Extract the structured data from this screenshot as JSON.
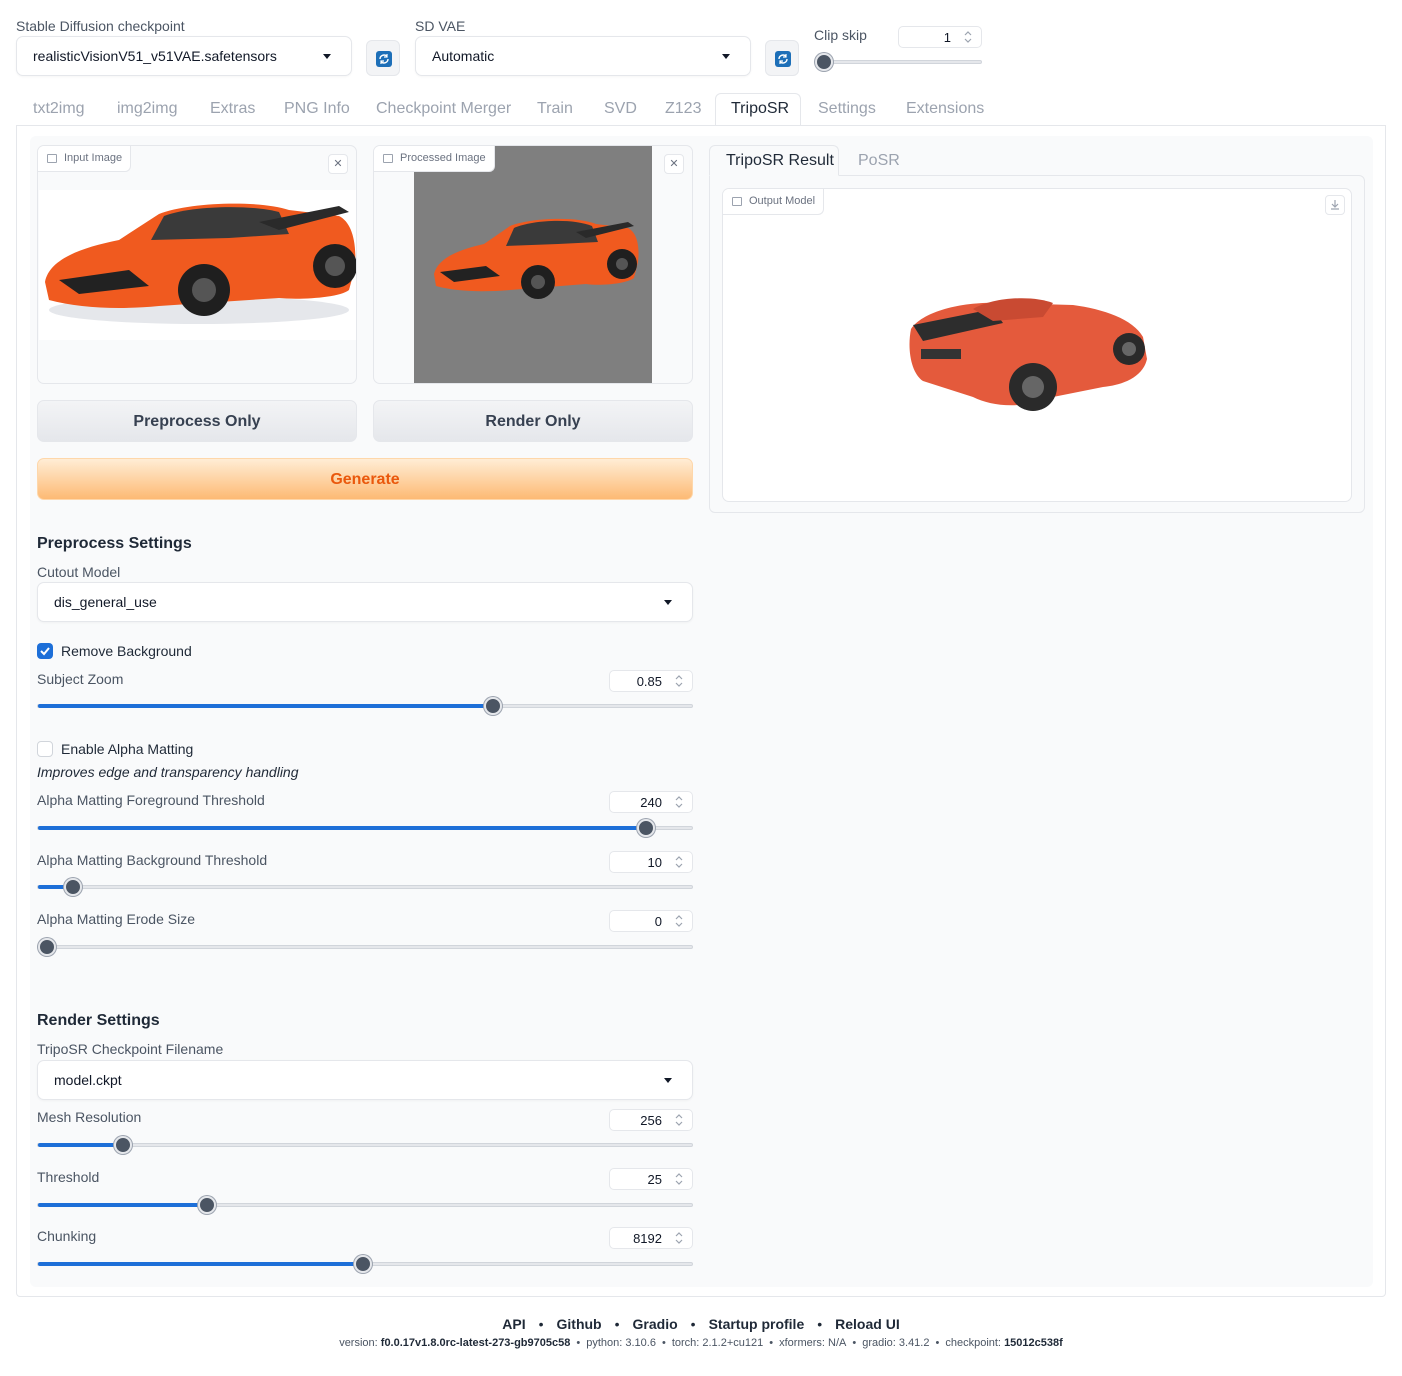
{
  "top": {
    "checkpoint_label": "Stable Diffusion checkpoint",
    "checkpoint_value": "realisticVisionV51_v51VAE.safetensors",
    "vae_label": "SD VAE",
    "vae_value": "Automatic",
    "clip_skip_label": "Clip skip",
    "clip_skip_value": "1",
    "clip_skip_fraction": 0.0
  },
  "tabs": [
    "txt2img",
    "img2img",
    "Extras",
    "PNG Info",
    "Checkpoint Merger",
    "Train",
    "SVD",
    "Z123",
    "TripoSR",
    "Settings",
    "Extensions"
  ],
  "active_tab": "TripoSR",
  "left": {
    "input_image_label": "Input Image",
    "processed_image_label": "Processed Image",
    "preprocess_button": "Preprocess Only",
    "render_button": "Render Only",
    "generate_button": "Generate"
  },
  "right": {
    "tabs": [
      "TripoSR Result",
      "PoSR"
    ],
    "output_label": "Output Model"
  },
  "preprocess": {
    "title": "Preprocess Settings",
    "cutout_label": "Cutout Model",
    "cutout_value": "dis_general_use",
    "remove_bg_label": "Remove Background",
    "remove_bg_checked": true,
    "subject_zoom_label": "Subject Zoom",
    "subject_zoom_value": "0.85",
    "subject_zoom_fraction": 0.695,
    "alpha_matting_label": "Enable Alpha Matting",
    "alpha_matting_checked": false,
    "alpha_matting_info": "Improves edge and transparency handling",
    "fg_threshold_label": "Alpha Matting Foreground Threshold",
    "fg_threshold_value": "240",
    "fg_threshold_fraction": 0.93,
    "bg_threshold_label": "Alpha Matting Background Threshold",
    "bg_threshold_value": "10",
    "bg_threshold_fraction": 0.053,
    "erode_label": "Alpha Matting Erode Size",
    "erode_value": "0",
    "erode_fraction": 0.0
  },
  "render": {
    "title": "Render Settings",
    "ckpt_label": "TripoSR Checkpoint Filename",
    "ckpt_value": "model.ckpt",
    "mesh_label": "Mesh Resolution",
    "mesh_value": "256",
    "mesh_fraction": 0.13,
    "threshold_label": "Threshold",
    "threshold_value": "25",
    "threshold_fraction": 0.258,
    "chunking_label": "Chunking",
    "chunking_value": "8192",
    "chunking_fraction": 0.497
  },
  "footer": {
    "links": [
      "API",
      "Github",
      "Gradio",
      "Startup profile",
      "Reload UI"
    ],
    "version_label": "version:",
    "version_value": "f0.0.17v1.8.0rc-latest-273-gb9705c58",
    "python": "python: 3.10.6",
    "torch": "torch: 2.1.2+cu121",
    "xformers": "xformers: N/A",
    "gradio": "gradio: 3.41.2",
    "checkpoint_label": "checkpoint:",
    "checkpoint_value": "15012c538f"
  },
  "colors": {
    "accent_blue": "#1d6fd8",
    "primary_orange": "#ea580c"
  }
}
